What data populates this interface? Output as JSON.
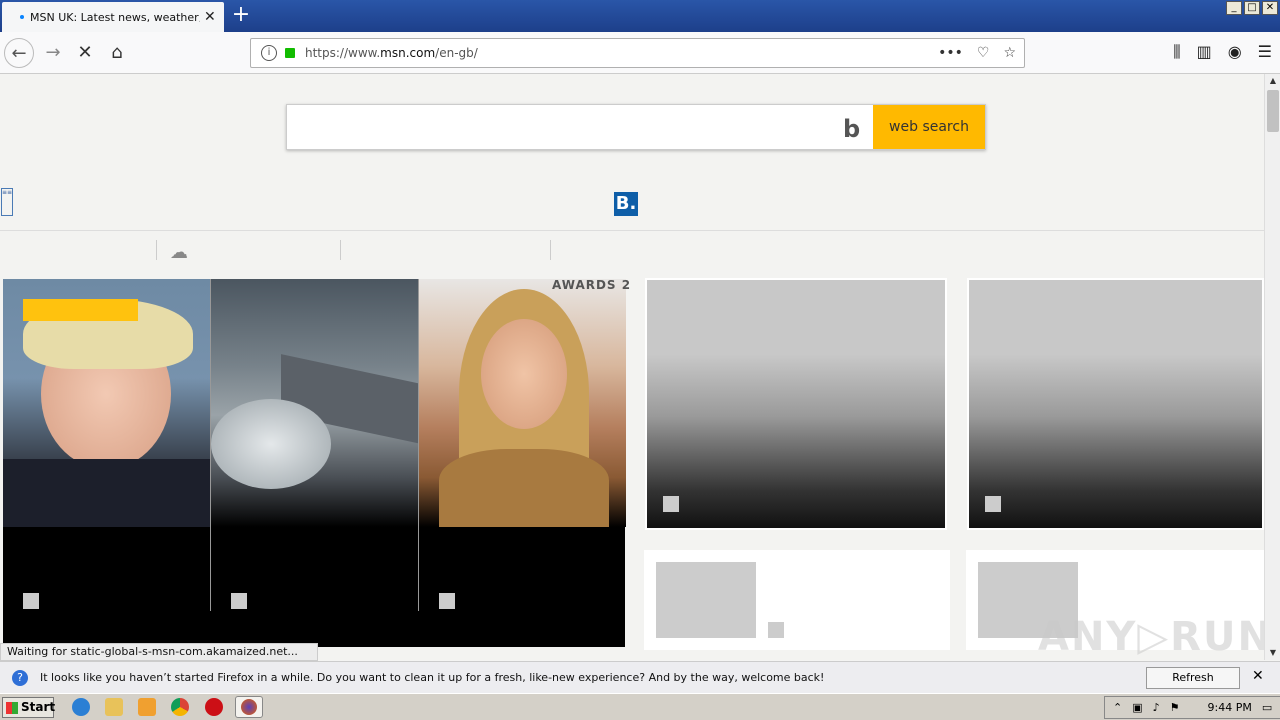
{
  "browser": {
    "tab_title": "MSN UK: Latest news, weather, H",
    "new_tab_label": "+",
    "window_buttons": [
      "_",
      "□",
      "✕"
    ],
    "url_prefix": "https://www.",
    "url_domain": "msn.com",
    "url_path": "/en-gb/",
    "page_actions": "•••",
    "status_text": "Waiting for static-global-s-msn-com.akamaized.net..."
  },
  "page": {
    "search_button": "web search",
    "bing_glyph": "b",
    "b_logo": "B.",
    "awards_text": "AWARDS 2",
    "side_logo": "≡≡"
  },
  "notification": {
    "message": "It looks like you haven’t started Firefox in a while. Do you want to clean it up for a fresh, like-new experience? And by the way, welcome back!",
    "refresh_button": "Refresh Firefox…",
    "close": "✕"
  },
  "taskbar": {
    "start_label": "Start",
    "clock": "9:44 PM"
  },
  "watermark": "ANY▷RUN",
  "colors": {
    "accent": "#ffb900",
    "titlebar": "#2a56a8",
    "tag_yellow": "#ffc20e"
  }
}
